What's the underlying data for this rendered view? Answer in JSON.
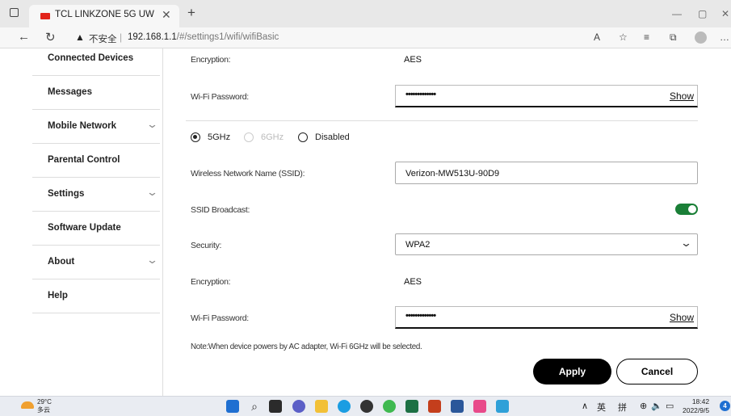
{
  "browser": {
    "tab_title": "TCL LINKZONE 5G UW",
    "insecure_label": "不安全",
    "url_host": "192.168.1.1",
    "url_path": "/#/settings1/wifi/wifiBasic"
  },
  "sidebar": {
    "items": [
      {
        "label": "Connected Devices",
        "expandable": false
      },
      {
        "label": "Messages",
        "expandable": false
      },
      {
        "label": "Mobile Network",
        "expandable": true
      },
      {
        "label": "Parental Control",
        "expandable": false
      },
      {
        "label": "Settings",
        "expandable": true
      },
      {
        "label": "Software Update",
        "expandable": false
      },
      {
        "label": "About",
        "expandable": true
      },
      {
        "label": "Help",
        "expandable": false
      }
    ]
  },
  "wifi_24": {
    "encryption_label": "Encryption:",
    "encryption_value": "AES",
    "password_label": "Wi-Fi Password:",
    "password_value": "•••••••••••••",
    "show_label": "Show"
  },
  "band": {
    "options": [
      {
        "label": "5GHz",
        "selected": true,
        "disabled": false
      },
      {
        "label": "6GHz",
        "selected": false,
        "disabled": true
      },
      {
        "label": "Disabled",
        "selected": false,
        "disabled": false
      }
    ]
  },
  "wifi_5": {
    "ssid_label": "Wireless Network Name (SSID):",
    "ssid_value": "Verizon-MW513U-90D9",
    "broadcast_label": "SSID Broadcast:",
    "broadcast_on": true,
    "security_label": "Security:",
    "security_value": "WPA2",
    "encryption_label": "Encryption:",
    "encryption_value": "AES",
    "password_label": "Wi-Fi Password:",
    "password_value": "•••••••••••••",
    "show_label": "Show"
  },
  "note": "Note:When device powers by AC adapter, Wi-Fi 6GHz will be selected.",
  "actions": {
    "apply": "Apply",
    "cancel": "Cancel"
  },
  "colors": {
    "toggle_on": "#1a7f37",
    "apply_bg": "#000000"
  },
  "taskbar": {
    "temp": "29°C",
    "weather": "多云",
    "ime_lang": "英",
    "ime_mode": "拼",
    "time": "18:42",
    "date": "2022/9/5",
    "notifications": "4"
  }
}
